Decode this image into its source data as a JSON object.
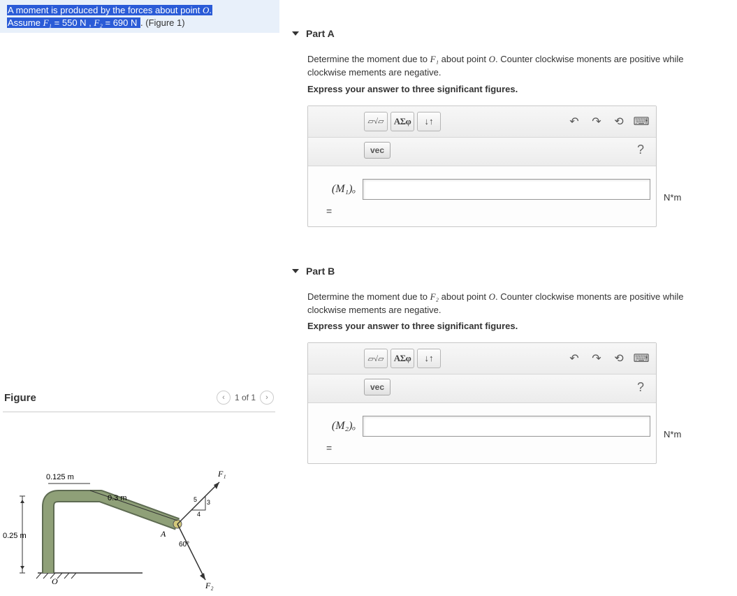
{
  "problem": {
    "line1a": "A moment is produced by the forces about point ",
    "pointO": "O",
    "line1b": ".",
    "line2a": "Assume ",
    "F1sym": "F₁",
    "eq1": " = 550 ",
    "unitN1": "N",
    "comma": " , ",
    "F2sym": "F₂",
    "eq2": " = 690 ",
    "unitN2": "N",
    "tail": " . (Figure 1)"
  },
  "figure": {
    "title": "Figure",
    "pager": "1 of 1",
    "labels": {
      "d1": "0.125 m",
      "d2": "0.3 m",
      "d3": "0.25 m",
      "ang1": "60°",
      "ratio_h": "5",
      "ratio_v": "3",
      "ratio_b": "4",
      "A": "A",
      "O": "O",
      "F1": "F₁",
      "F2": "F₂"
    }
  },
  "partA": {
    "title": "Part A",
    "instr_a": "Determine the moment due to ",
    "instr_F": "F₁",
    "instr_b": " about point ",
    "instr_O": "O",
    "instr_c": ". Counter clockwise monents are positive while clockwise mements are negative.",
    "bold": "Express your answer to three significant figures.",
    "label": "(M₁)ₒ",
    "equals": "=",
    "unit": "N*m"
  },
  "partB": {
    "title": "Part B",
    "instr_a": "Determine the moment due to ",
    "instr_F": "F₂",
    "instr_b": " about point ",
    "instr_O": "O",
    "instr_c": ". Counter clockwise monents are positive while clockwise mements are negative.",
    "bold": "Express your answer to three significant figures.",
    "label": "(M₂)ₒ",
    "equals": "=",
    "unit": "N*m"
  },
  "toolbar": {
    "template": "▱√▱",
    "greek": "ΑΣφ",
    "arrows": "↓↑",
    "vec": "vec",
    "help": "?"
  }
}
